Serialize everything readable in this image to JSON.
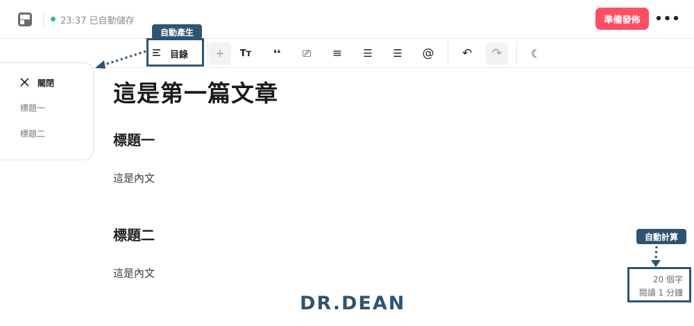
{
  "header": {
    "save_status": "23:37 已自動儲存",
    "publish_label": "準備發佈",
    "more_label": "•••",
    "status_color": "#3fb2a1",
    "accent_color": "#ff4f64"
  },
  "toolbar": {
    "toc_label": "目錄",
    "buttons": [
      {
        "icon": "plus-icon",
        "glyph": "+"
      },
      {
        "icon": "font-size-icon",
        "glyph": "Tт"
      },
      {
        "icon": "quote-icon",
        "glyph": "❛❛"
      },
      {
        "icon": "embed-icon",
        "glyph": "⎚"
      },
      {
        "icon": "align-center-icon",
        "glyph": "≡"
      },
      {
        "icon": "bullet-list-icon",
        "glyph": "☰"
      },
      {
        "icon": "numbered-list-icon",
        "glyph": "☰"
      },
      {
        "icon": "mention-icon",
        "glyph": "@"
      },
      {
        "icon": "undo-icon",
        "glyph": "↶"
      },
      {
        "icon": "redo-icon",
        "glyph": "↷"
      },
      {
        "icon": "dark-mode-icon",
        "glyph": "☾"
      }
    ]
  },
  "annotations": {
    "toc_callout": "自動產生",
    "count_callout": "自動計算",
    "callout_color": "#2f5472"
  },
  "outline": {
    "close_label": "關閉",
    "items": [
      "標題一",
      "標題二"
    ]
  },
  "document": {
    "title": "這是第一篇文章",
    "sections": [
      {
        "heading": "標題一",
        "body": "這是內文"
      },
      {
        "heading": "標題二",
        "body": "這是內文"
      }
    ]
  },
  "stats": {
    "word_count": "20 個字",
    "reading_time": "閱讀 1 分鐘"
  },
  "watermark": "DR.DEAN"
}
